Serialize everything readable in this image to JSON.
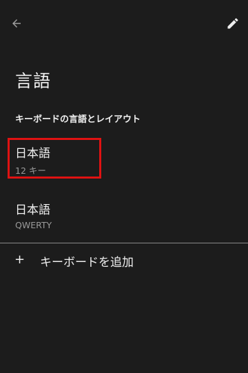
{
  "topbar": {
    "back_icon": "arrow-left-icon",
    "edit_icon": "pencil-icon"
  },
  "page": {
    "title": "言語"
  },
  "section": {
    "header": "キーボードの言語とレイアウト"
  },
  "languages": [
    {
      "title": "日本語",
      "subtitle": "12 キー",
      "highlighted": true
    },
    {
      "title": "日本語",
      "subtitle": "QWERTY",
      "highlighted": false
    }
  ],
  "add_keyboard": {
    "icon": "+",
    "label": "キーボードを追加"
  },
  "colors": {
    "background": "#1c1c1c",
    "highlight": "#e01212",
    "secondary_text": "#9a9a9a"
  }
}
